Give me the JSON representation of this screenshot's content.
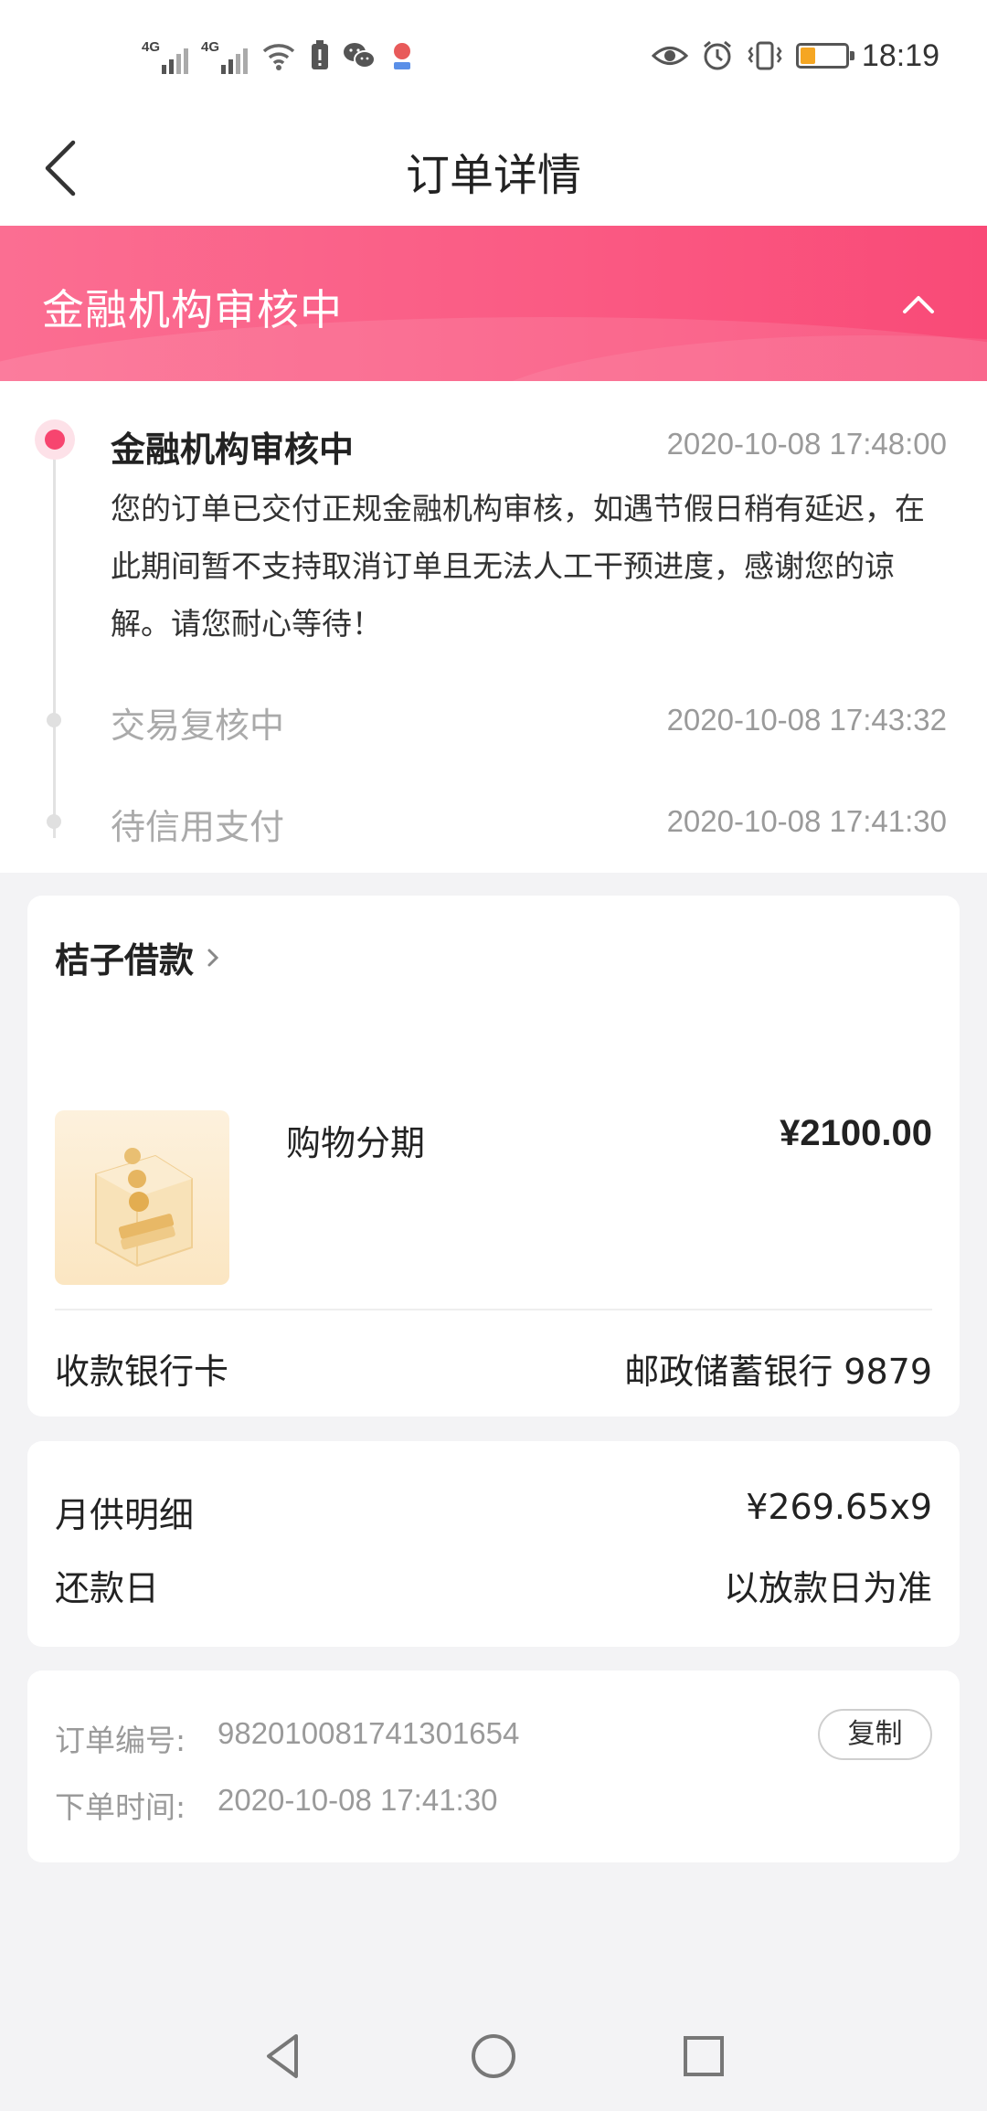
{
  "status_bar": {
    "net1": "4G",
    "net2": "4G",
    "time": "18:19",
    "battery_level": 0.2
  },
  "nav": {
    "title": "订单详情"
  },
  "banner": {
    "status": "金融机构审核中"
  },
  "timeline": {
    "current": {
      "title": "金融机构审核中",
      "time": "2020-10-08 17:48:00",
      "description": "您的订单已交付正规金融机构审核，如遇节假日稍有延迟，在此期间暂不支持取消订单且无法人工干预进度，感谢您的谅解。请您耐心等待！"
    },
    "history": [
      {
        "title": "交易复核中",
        "time": "2020-10-08 17:43:32"
      },
      {
        "title": "待信用支付",
        "time": "2020-10-08 17:41:30"
      }
    ]
  },
  "merchant_card": {
    "merchant": "桔子借款",
    "product_name": "购物分期",
    "product_price": "¥2100.00",
    "bank_label": "收款银行卡",
    "bank_value": "邮政储蓄银行 9879"
  },
  "repay_card": {
    "monthly_label": "月供明细",
    "monthly_value": "¥269.65x9",
    "due_label": "还款日",
    "due_value": "以放款日为准"
  },
  "order_card": {
    "number_label": "订单编号:",
    "number_value": "982010081741301654",
    "time_label": "下单时间:",
    "time_value": "2020-10-08 17:41:30",
    "copy_label": "复制"
  },
  "colors": {
    "accent": "#f7456f",
    "banner_start": "#fb6e92",
    "banner_end": "#f94a77"
  },
  "icons": [
    "back-icon",
    "chevron-up-icon",
    "chevron-right-icon",
    "nav-back-icon",
    "nav-home-icon",
    "nav-recents-icon"
  ]
}
